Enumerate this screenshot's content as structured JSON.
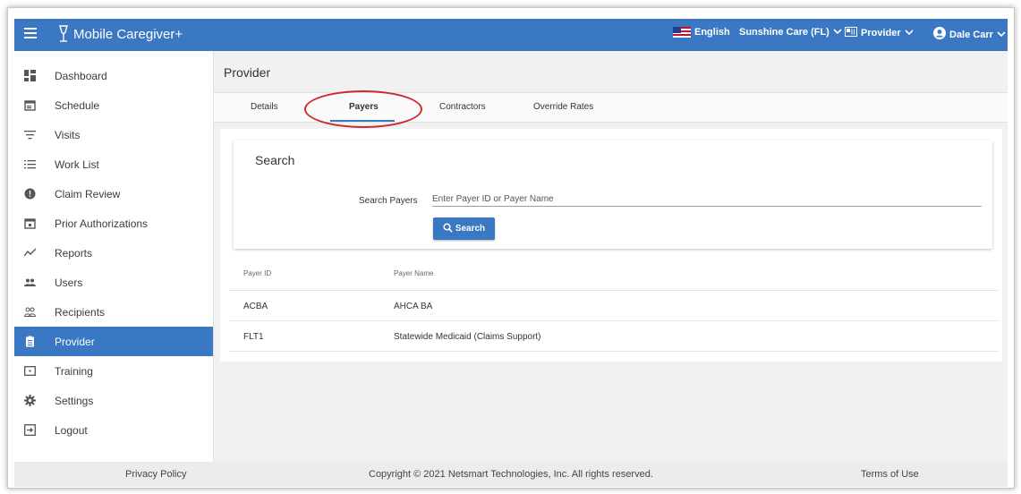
{
  "app": {
    "name": "Mobile Caregiver+"
  },
  "header": {
    "language": "English",
    "agency": "Sunshine Care (FL)",
    "role": "Provider",
    "user": "Dale Carr"
  },
  "sidebar": {
    "items": [
      {
        "label": "Dashboard",
        "icon": "dashboard-icon"
      },
      {
        "label": "Schedule",
        "icon": "calendar-icon"
      },
      {
        "label": "Visits",
        "icon": "filter-icon"
      },
      {
        "label": "Work List",
        "icon": "list-icon"
      },
      {
        "label": "Claim Review",
        "icon": "alert-icon"
      },
      {
        "label": "Prior Authorizations",
        "icon": "calendar-check-icon"
      },
      {
        "label": "Reports",
        "icon": "trend-icon"
      },
      {
        "label": "Users",
        "icon": "group-icon"
      },
      {
        "label": "Recipients",
        "icon": "people-outline-icon"
      },
      {
        "label": "Provider",
        "icon": "clipboard-icon"
      },
      {
        "label": "Training",
        "icon": "video-icon"
      },
      {
        "label": "Settings",
        "icon": "gear-icon"
      },
      {
        "label": "Logout",
        "icon": "logout-icon"
      }
    ],
    "active": "Provider"
  },
  "page": {
    "title": "Provider"
  },
  "tabs": [
    {
      "label": "Details"
    },
    {
      "label": "Payers"
    },
    {
      "label": "Contractors"
    },
    {
      "label": "Override Rates"
    }
  ],
  "active_tab": "Payers",
  "search": {
    "heading": "Search",
    "label": "Search Payers",
    "placeholder": "Enter Payer ID or Payer Name",
    "button": "Search"
  },
  "table": {
    "columns": [
      "Payer ID",
      "Payer Name"
    ],
    "rows": [
      {
        "id": "ACBA",
        "name": "AHCA BA"
      },
      {
        "id": "FLT1",
        "name": "Statewide Medicaid (Claims Support)"
      }
    ]
  },
  "footer": {
    "privacy": "Privacy Policy",
    "copyright": "Copyright © 2021 Netsmart Technologies, Inc. All rights reserved.",
    "terms": "Terms of Use"
  },
  "colors": {
    "accent": "#3a78c4",
    "annotation": "#cf2a2a"
  }
}
